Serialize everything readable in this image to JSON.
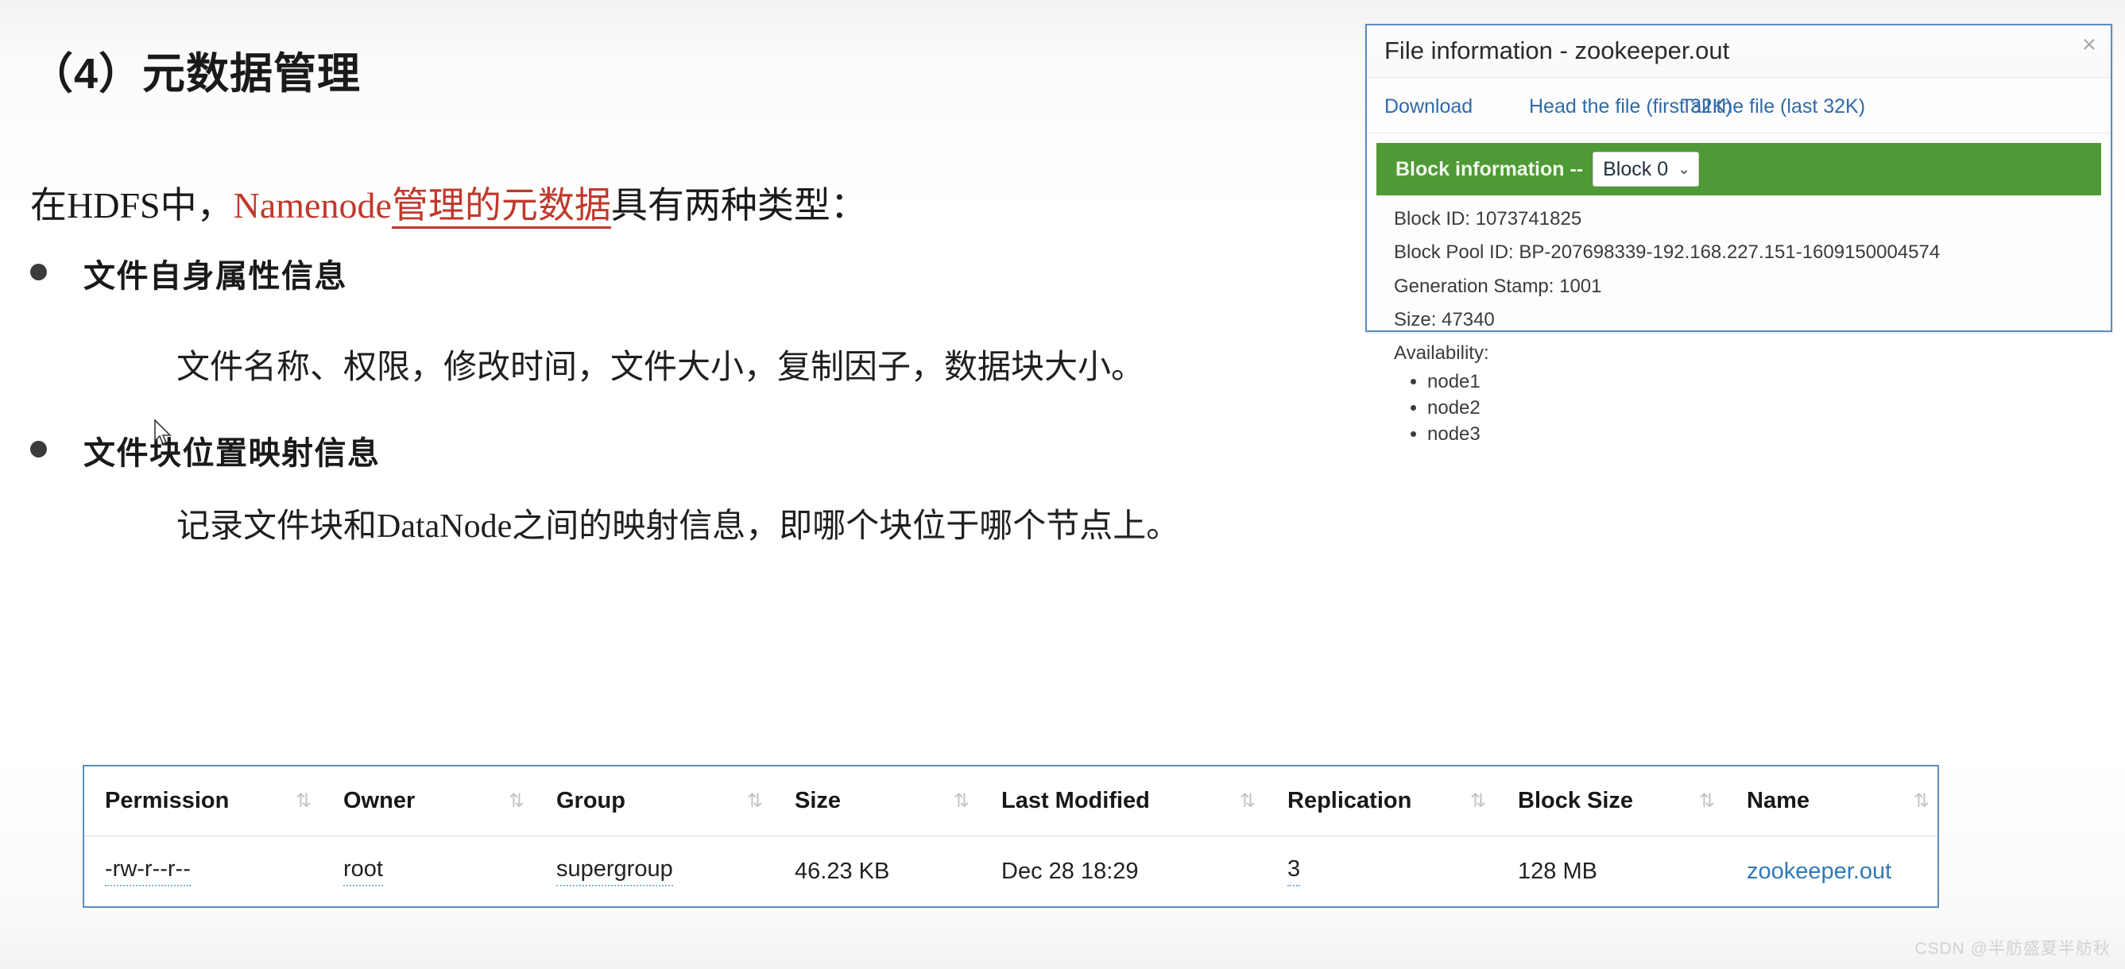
{
  "slide": {
    "title": "（4）元数据管理",
    "intro": {
      "part1": "在HDFS中，",
      "highlight_plain": "Namenode",
      "highlight_underlined": "管理的元数据",
      "part2": "具有两种类型："
    },
    "bullets": [
      {
        "label": "文件自身属性信息",
        "detail": "文件名称、权限，修改时间，文件大小，复制因子，数据块大小。"
      },
      {
        "label": "文件块位置映射信息",
        "detail": "记录文件块和DataNode之间的映射信息，即哪个块位于哪个节点上。"
      }
    ],
    "highlight_color": "#c0392b"
  },
  "file_info_panel": {
    "title": "File information - zookeeper.out",
    "close_label": "×",
    "links": [
      "Download",
      "Head the file (first 32K)",
      "Tail the file (last 32K)"
    ],
    "block_bar": {
      "label": "Block information --",
      "selected_block": "Block 0",
      "chevron": "⌄",
      "bar_color": "#4f9a36"
    },
    "details": [
      "Block ID: 1073741825",
      "Block Pool ID: BP-207698339-192.168.227.151-1609150004574",
      "Generation Stamp: 1001",
      "Size: 47340"
    ],
    "availability_label": "Availability:",
    "availability_nodes": [
      "node1",
      "node2",
      "node3"
    ]
  },
  "file_table": {
    "sort_icon": "⇅",
    "headers": [
      "Permission",
      "Owner",
      "Group",
      "Size",
      "Last Modified",
      "Replication",
      "Block Size",
      "Name"
    ],
    "rows": [
      {
        "permission": "-rw-r--r--",
        "owner": "root",
        "group": "supergroup",
        "size": "46.23 KB",
        "last_modified": "Dec 28 18:29",
        "replication": "3",
        "block_size": "128 MB",
        "name": "zookeeper.out"
      }
    ],
    "link_color": "#3178b4"
  },
  "watermark": "CSDN @半舫盛夏半舫秋"
}
